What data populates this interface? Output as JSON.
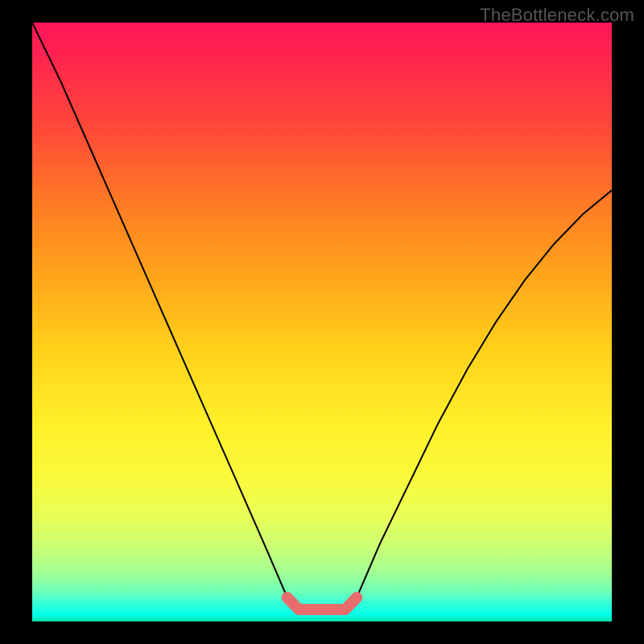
{
  "watermark": "TheBottleneck.com",
  "chart_data": {
    "type": "line",
    "title": "",
    "xlabel": "",
    "ylabel": "",
    "xlim": [
      0,
      100
    ],
    "ylim": [
      0,
      100
    ],
    "grid": false,
    "series": [
      {
        "name": "bottleneck-curve",
        "x": [
          0,
          5,
          10,
          15,
          20,
          25,
          30,
          35,
          40,
          44,
          46,
          50,
          54,
          56,
          60,
          65,
          70,
          75,
          80,
          85,
          90,
          95,
          100
        ],
        "y": [
          100,
          90,
          79,
          68,
          57,
          46,
          35,
          24,
          13,
          4,
          2,
          2,
          2,
          4,
          13,
          23,
          33,
          42,
          50,
          57,
          63,
          68,
          72
        ],
        "stroke": "#000000",
        "stroke_width": 2
      },
      {
        "name": "highlight-valley",
        "x": [
          44,
          46,
          50,
          54,
          56
        ],
        "y": [
          4,
          2,
          2,
          2,
          4
        ],
        "stroke": "#e86c6c",
        "stroke_width": 14
      }
    ],
    "background_gradient": {
      "top": "#ff1459",
      "bottom": "#00e1a8",
      "description": "vertical red-to-green gradient"
    }
  }
}
